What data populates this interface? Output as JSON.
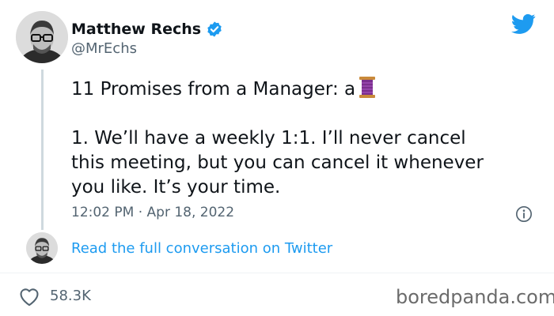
{
  "author": {
    "name": "Matthew Rechs",
    "handle": "@MrEchs"
  },
  "tweet": {
    "text": "11 Promises from a Manager: a",
    "body": "1. We’ll have a weekly 1:1. I’ll never cancel\nthis meeting, but you can cancel it whenever\nyou like. It’s your time.",
    "timestamp": "12:02 PM · Apr 18, 2022"
  },
  "conversation_link": "Read the full conversation on Twitter",
  "likes": "58.3K",
  "watermark": "boredpanda.com",
  "colors": {
    "link": "#1d9bf0",
    "muted": "#536471",
    "verified": "#1d9bf0",
    "divider": "#eff3f4"
  },
  "icons": [
    "verified-badge-icon",
    "twitter-bird-icon",
    "thread-spool-icon",
    "info-icon",
    "heart-icon"
  ]
}
